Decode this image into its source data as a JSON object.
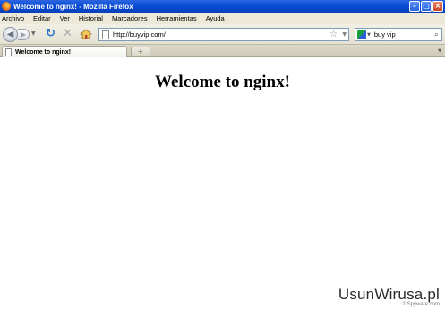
{
  "window": {
    "title": "Welcome to nginx! - Mozilla Firefox"
  },
  "menu": {
    "items": [
      "Archivo",
      "Editar",
      "Ver",
      "Historial",
      "Marcadores",
      "Herramientas",
      "Ayuda"
    ]
  },
  "navbar": {
    "url": "http://buyvip.com/",
    "search_value": "buy vip"
  },
  "tabs": [
    {
      "label": "Welcome to nginx!",
      "active": true
    }
  ],
  "page": {
    "heading": "Welcome to nginx!"
  },
  "watermark": {
    "main": "UsunWirusa",
    "suffix": ".pl",
    "sub": "2-Spyware.com"
  },
  "icons": {
    "app": "firefox-icon",
    "back": "back-arrow-icon",
    "forward": "forward-arrow-icon",
    "reload": "reload-icon",
    "stop": "stop-icon",
    "home": "home-icon",
    "bookmark": "star-icon",
    "search_engine": "google-icon",
    "search_go": "magnifier-icon"
  },
  "colors": {
    "titlebar": "#0a4fd6",
    "chrome": "#ece9d8",
    "reload": "#2e73c9"
  }
}
